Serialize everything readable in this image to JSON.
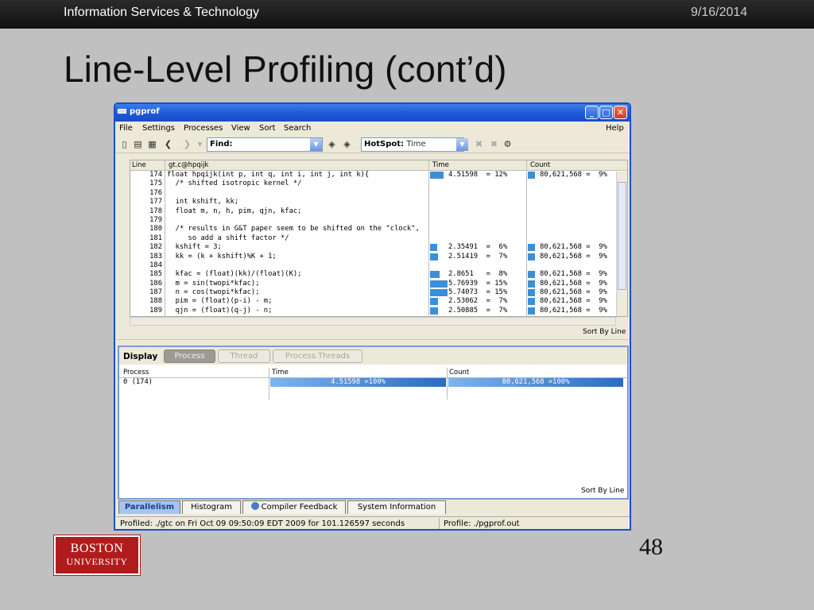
{
  "slide": {
    "org": "Information Services & Technology",
    "date": "9/16/2014",
    "title": "Line-Level Profiling (cont’d)",
    "page_number": "48",
    "logo_line1": "BOSTON",
    "logo_line2": "UNIVERSITY",
    "colors": {
      "background": "#c0c0c0",
      "logo": "#b01c1c",
      "header": "#1a1a1a"
    }
  },
  "window": {
    "title": "pgprof",
    "buttons": {
      "minimize": "_",
      "maximize": "□",
      "close": "✕"
    },
    "menu": {
      "file": "File",
      "settings": "Settings",
      "processes": "Processes",
      "view": "View",
      "sort": "Sort",
      "search": "Search",
      "help": "Help"
    },
    "toolbar": {
      "icons": [
        "open-icon",
        "print-icon",
        "save-icon",
        "back-icon",
        "forward-icon",
        "find-prev-icon",
        "find-next-icon",
        "hotspot-clear-icon",
        "hotspot-next-icon",
        "hotspot-settings-icon"
      ],
      "find_label": "Find:",
      "find_value": "",
      "hotspot_label": "HotSpot:",
      "hotspot_value": "Time"
    },
    "grid": {
      "headers": {
        "line": "Line",
        "file": "gt.c@hpqijk",
        "time": "Time",
        "count": "Count"
      },
      "rows": [
        {
          "line": "174",
          "code": "float hpqijk(int p, int q, int i, int j, int k){",
          "time": "4.51598  = 12%",
          "time_pct": 12,
          "count": "80,621,568 =  9%"
        },
        {
          "line": "175",
          "code": "  /* shifted isotropic kernel */",
          "time": "",
          "time_pct": 0,
          "count": ""
        },
        {
          "line": "176",
          "code": "",
          "time": "",
          "time_pct": 0,
          "count": ""
        },
        {
          "line": "177",
          "code": "  int kshift, kk;",
          "time": "",
          "time_pct": 0,
          "count": ""
        },
        {
          "line": "178",
          "code": "  float m, n, h, pim, qjn, kfac;",
          "time": "",
          "time_pct": 0,
          "count": ""
        },
        {
          "line": "179",
          "code": "",
          "time": "",
          "time_pct": 0,
          "count": ""
        },
        {
          "line": "180",
          "code": "  /* results in G&T paper seem to be shifted on the \"clock\",",
          "time": "",
          "time_pct": 0,
          "count": ""
        },
        {
          "line": "181",
          "code": "     so add a shift factor */",
          "time": "",
          "time_pct": 0,
          "count": ""
        },
        {
          "line": "182",
          "code": "  kshift = 3;",
          "time": "2.35491  =  6%",
          "time_pct": 6,
          "count": "80,621,568 =  9%"
        },
        {
          "line": "183",
          "code": "  kk = (k + kshift)%K + 1;",
          "time": "2.51419  =  7%",
          "time_pct": 7,
          "count": "80,621,568 =  9%"
        },
        {
          "line": "184",
          "code": "",
          "time": "",
          "time_pct": 0,
          "count": ""
        },
        {
          "line": "185",
          "code": "  kfac = (float)(kk)/(float)(K);",
          "time": "2.8651   =  8%",
          "time_pct": 8,
          "count": "80,621,568 =  9%"
        },
        {
          "line": "186",
          "code": "  m = sin(twopi*kfac);",
          "time": "5.76939  = 15%",
          "time_pct": 15,
          "count": "80,621,568 =  9%"
        },
        {
          "line": "187",
          "code": "  n = cos(twopi*kfac);",
          "time": "5.74073  = 15%",
          "time_pct": 15,
          "count": "80,621,568 =  9%"
        },
        {
          "line": "188",
          "code": "  pim = (float)(p-i) - m;",
          "time": "2.53062  =  7%",
          "time_pct": 7,
          "count": "80,621,568 =  9%"
        },
        {
          "line": "189",
          "code": "  qjn = (float)(q-j) - n;",
          "time": "2.50885  =  7%",
          "time_pct": 7,
          "count": "80,621,568 =  9%"
        }
      ],
      "sort_label": "Sort By Line"
    },
    "display": {
      "label": "Display",
      "buttons": [
        "Process",
        "Thread",
        "Process.Threads"
      ],
      "headers": {
        "process": "Process",
        "time": "Time",
        "count": "Count"
      },
      "row": {
        "process": "0 (174)",
        "time": "4.51598  =100%",
        "count": "80,621,568 =100%"
      },
      "sort_label": "Sort By Line"
    },
    "tabs": [
      "Parallelism",
      "Histogram",
      "Compiler Feedback",
      "System Information"
    ],
    "status": {
      "profiled": "Profiled: ./gtc on Fri Oct 09 09:50:09 EDT 2009 for 101.126597 seconds",
      "profile": "Profile: ./pgprof.out"
    }
  }
}
